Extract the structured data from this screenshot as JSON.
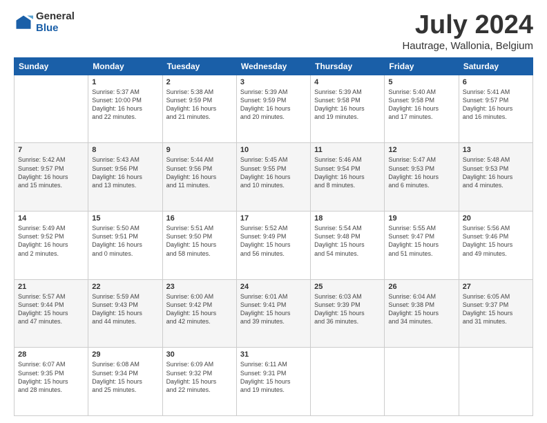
{
  "header": {
    "logo_general": "General",
    "logo_blue": "Blue",
    "month_title": "July 2024",
    "location": "Hautrage, Wallonia, Belgium"
  },
  "days_of_week": [
    "Sunday",
    "Monday",
    "Tuesday",
    "Wednesday",
    "Thursday",
    "Friday",
    "Saturday"
  ],
  "weeks": [
    [
      {
        "day": "",
        "text": ""
      },
      {
        "day": "1",
        "text": "Sunrise: 5:37 AM\nSunset: 10:00 PM\nDaylight: 16 hours\nand 22 minutes."
      },
      {
        "day": "2",
        "text": "Sunrise: 5:38 AM\nSunset: 9:59 PM\nDaylight: 16 hours\nand 21 minutes."
      },
      {
        "day": "3",
        "text": "Sunrise: 5:39 AM\nSunset: 9:59 PM\nDaylight: 16 hours\nand 20 minutes."
      },
      {
        "day": "4",
        "text": "Sunrise: 5:39 AM\nSunset: 9:58 PM\nDaylight: 16 hours\nand 19 minutes."
      },
      {
        "day": "5",
        "text": "Sunrise: 5:40 AM\nSunset: 9:58 PM\nDaylight: 16 hours\nand 17 minutes."
      },
      {
        "day": "6",
        "text": "Sunrise: 5:41 AM\nSunset: 9:57 PM\nDaylight: 16 hours\nand 16 minutes."
      }
    ],
    [
      {
        "day": "7",
        "text": "Sunrise: 5:42 AM\nSunset: 9:57 PM\nDaylight: 16 hours\nand 15 minutes."
      },
      {
        "day": "8",
        "text": "Sunrise: 5:43 AM\nSunset: 9:56 PM\nDaylight: 16 hours\nand 13 minutes."
      },
      {
        "day": "9",
        "text": "Sunrise: 5:44 AM\nSunset: 9:56 PM\nDaylight: 16 hours\nand 11 minutes."
      },
      {
        "day": "10",
        "text": "Sunrise: 5:45 AM\nSunset: 9:55 PM\nDaylight: 16 hours\nand 10 minutes."
      },
      {
        "day": "11",
        "text": "Sunrise: 5:46 AM\nSunset: 9:54 PM\nDaylight: 16 hours\nand 8 minutes."
      },
      {
        "day": "12",
        "text": "Sunrise: 5:47 AM\nSunset: 9:53 PM\nDaylight: 16 hours\nand 6 minutes."
      },
      {
        "day": "13",
        "text": "Sunrise: 5:48 AM\nSunset: 9:53 PM\nDaylight: 16 hours\nand 4 minutes."
      }
    ],
    [
      {
        "day": "14",
        "text": "Sunrise: 5:49 AM\nSunset: 9:52 PM\nDaylight: 16 hours\nand 2 minutes."
      },
      {
        "day": "15",
        "text": "Sunrise: 5:50 AM\nSunset: 9:51 PM\nDaylight: 16 hours\nand 0 minutes."
      },
      {
        "day": "16",
        "text": "Sunrise: 5:51 AM\nSunset: 9:50 PM\nDaylight: 15 hours\nand 58 minutes."
      },
      {
        "day": "17",
        "text": "Sunrise: 5:52 AM\nSunset: 9:49 PM\nDaylight: 15 hours\nand 56 minutes."
      },
      {
        "day": "18",
        "text": "Sunrise: 5:54 AM\nSunset: 9:48 PM\nDaylight: 15 hours\nand 54 minutes."
      },
      {
        "day": "19",
        "text": "Sunrise: 5:55 AM\nSunset: 9:47 PM\nDaylight: 15 hours\nand 51 minutes."
      },
      {
        "day": "20",
        "text": "Sunrise: 5:56 AM\nSunset: 9:46 PM\nDaylight: 15 hours\nand 49 minutes."
      }
    ],
    [
      {
        "day": "21",
        "text": "Sunrise: 5:57 AM\nSunset: 9:44 PM\nDaylight: 15 hours\nand 47 minutes."
      },
      {
        "day": "22",
        "text": "Sunrise: 5:59 AM\nSunset: 9:43 PM\nDaylight: 15 hours\nand 44 minutes."
      },
      {
        "day": "23",
        "text": "Sunrise: 6:00 AM\nSunset: 9:42 PM\nDaylight: 15 hours\nand 42 minutes."
      },
      {
        "day": "24",
        "text": "Sunrise: 6:01 AM\nSunset: 9:41 PM\nDaylight: 15 hours\nand 39 minutes."
      },
      {
        "day": "25",
        "text": "Sunrise: 6:03 AM\nSunset: 9:39 PM\nDaylight: 15 hours\nand 36 minutes."
      },
      {
        "day": "26",
        "text": "Sunrise: 6:04 AM\nSunset: 9:38 PM\nDaylight: 15 hours\nand 34 minutes."
      },
      {
        "day": "27",
        "text": "Sunrise: 6:05 AM\nSunset: 9:37 PM\nDaylight: 15 hours\nand 31 minutes."
      }
    ],
    [
      {
        "day": "28",
        "text": "Sunrise: 6:07 AM\nSunset: 9:35 PM\nDaylight: 15 hours\nand 28 minutes."
      },
      {
        "day": "29",
        "text": "Sunrise: 6:08 AM\nSunset: 9:34 PM\nDaylight: 15 hours\nand 25 minutes."
      },
      {
        "day": "30",
        "text": "Sunrise: 6:09 AM\nSunset: 9:32 PM\nDaylight: 15 hours\nand 22 minutes."
      },
      {
        "day": "31",
        "text": "Sunrise: 6:11 AM\nSunset: 9:31 PM\nDaylight: 15 hours\nand 19 minutes."
      },
      {
        "day": "",
        "text": ""
      },
      {
        "day": "",
        "text": ""
      },
      {
        "day": "",
        "text": ""
      }
    ]
  ]
}
